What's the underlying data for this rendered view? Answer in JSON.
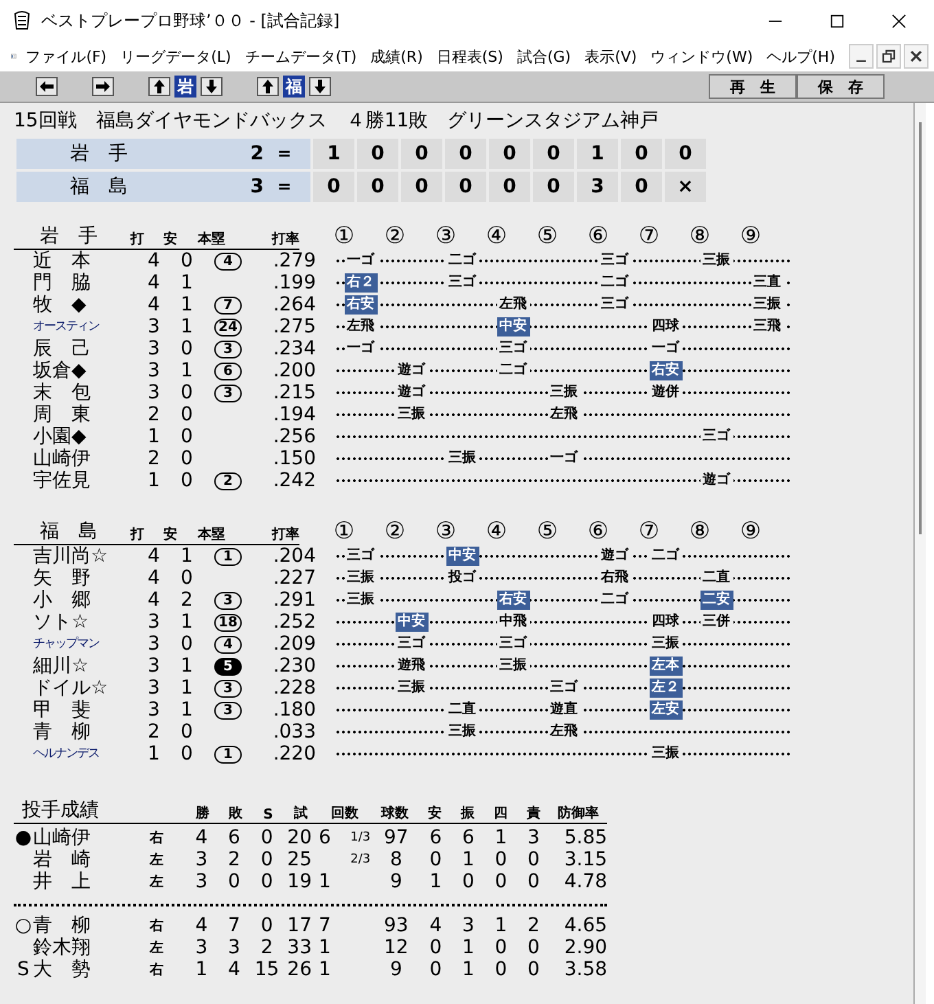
{
  "window": {
    "title": "ベストプレープロ野球’００ - [試合記録]"
  },
  "menu": [
    "ファイル(F)",
    "リーグデータ(L)",
    "チームデータ(T)",
    "成績(R)",
    "日程表(S)",
    "試合(G)",
    "表示(V)",
    "ウィンドウ(W)",
    "ヘルプ(H)"
  ],
  "toolbar": {
    "away_team": "岩",
    "home_team": "福",
    "buttons": [
      "再　生",
      "保　存"
    ]
  },
  "game_header": "15回戦　福島ダイヤモンドバックス　４勝11敗　グリーンスタジアム神戸",
  "scoreboard": [
    {
      "team": "岩　手",
      "total": "2",
      "equals": "＝",
      "innings": [
        "1",
        "0",
        "0",
        "0",
        "0",
        "0",
        "1",
        "0",
        "0"
      ]
    },
    {
      "team": "福　島",
      "total": "3",
      "equals": "＝",
      "innings": [
        "0",
        "0",
        "0",
        "0",
        "0",
        "0",
        "3",
        "0",
        "×"
      ]
    }
  ],
  "batting": [
    {
      "team": "岩　手",
      "columns": [
        "打",
        "安",
        "本塁",
        "打率"
      ],
      "inning_headers": [
        "①",
        "②",
        "③",
        "④",
        "⑤",
        "⑥",
        "⑦",
        "⑧",
        "⑨"
      ],
      "rows": [
        {
          "name": "近　本",
          "ab": "4",
          "h": "0",
          "hr": "4",
          "hr_filled": false,
          "avg": ".279",
          "innings": {
            "inning_1": {
              "text": "一ゴ",
              "hit": false
            },
            "inning_3": {
              "text": "二ゴ",
              "hit": false
            },
            "inning_6": {
              "text": "三ゴ",
              "hit": false
            },
            "inning_8": {
              "text": "三振",
              "hit": false
            }
          }
        },
        {
          "name": "門　脇",
          "ab": "4",
          "h": "1",
          "avg": ".199",
          "innings": {
            "inning_1": {
              "text": "右２",
              "hit": true
            },
            "inning_3": {
              "text": "三ゴ",
              "hit": false
            },
            "inning_6": {
              "text": "二ゴ",
              "hit": false
            },
            "inning_9": {
              "text": "三直",
              "hit": false
            }
          }
        },
        {
          "name": "牧　◆",
          "ab": "4",
          "h": "1",
          "hr": "7",
          "hr_filled": false,
          "avg": ".264",
          "innings": {
            "inning_1": {
              "text": "右安",
              "hit": true
            },
            "inning_4": {
              "text": "左飛",
              "hit": false
            },
            "inning_6": {
              "text": "三ゴ",
              "hit": false
            },
            "inning_9": {
              "text": "三振",
              "hit": false
            }
          }
        },
        {
          "name": "オースティン",
          "ab": "3",
          "h": "1",
          "hr": "24",
          "hr_filled": false,
          "avg": ".275",
          "innings": {
            "inning_1": {
              "text": "左飛",
              "hit": false
            },
            "inning_4": {
              "text": "中安",
              "hit": true
            },
            "inning_7": {
              "text": "四球",
              "hit": false
            },
            "inning_9": {
              "text": "三飛",
              "hit": false
            }
          }
        },
        {
          "name": "辰　己",
          "ab": "3",
          "h": "0",
          "hr": "3",
          "hr_filled": false,
          "avg": ".234",
          "innings": {
            "inning_1": {
              "text": "一ゴ",
              "hit": false
            },
            "inning_4": {
              "text": "三ゴ",
              "hit": false
            },
            "inning_7": {
              "text": "一ゴ",
              "hit": false
            }
          }
        },
        {
          "name": "坂倉◆",
          "ab": "3",
          "h": "1",
          "hr": "6",
          "hr_filled": false,
          "avg": ".200",
          "innings": {
            "inning_2": {
              "text": "遊ゴ",
              "hit": false
            },
            "inning_4": {
              "text": "二ゴ",
              "hit": false
            },
            "inning_7": {
              "text": "右安",
              "hit": true
            }
          }
        },
        {
          "name": "末　包",
          "ab": "3",
          "h": "0",
          "hr": "3",
          "hr_filled": false,
          "avg": ".215",
          "innings": {
            "inning_2": {
              "text": "遊ゴ",
              "hit": false
            },
            "inning_5": {
              "text": "三振",
              "hit": false
            },
            "inning_7": {
              "text": "遊併",
              "hit": false
            }
          }
        },
        {
          "name": "周　東",
          "ab": "2",
          "h": "0",
          "avg": ".194",
          "innings": {
            "inning_2": {
              "text": "三振",
              "hit": false
            },
            "inning_5": {
              "text": "左飛",
              "hit": false
            }
          }
        },
        {
          "name": "小園◆",
          "ab": "1",
          "h": "0",
          "avg": ".256",
          "innings": {
            "inning_8": {
              "text": "三ゴ",
              "hit": false
            }
          }
        },
        {
          "name": "山崎伊",
          "ab": "2",
          "h": "0",
          "avg": ".150",
          "innings": {
            "inning_3": {
              "text": "三振",
              "hit": false
            },
            "inning_5": {
              "text": "一ゴ",
              "hit": false
            }
          }
        },
        {
          "name": "宇佐見",
          "ab": "1",
          "h": "0",
          "hr": "2",
          "hr_filled": false,
          "avg": ".242",
          "innings": {
            "inning_8": {
              "text": "遊ゴ",
              "hit": false
            }
          }
        }
      ]
    },
    {
      "team": "福　島",
      "columns": [
        "打",
        "安",
        "本塁",
        "打率"
      ],
      "inning_headers": [
        "①",
        "②",
        "③",
        "④",
        "⑤",
        "⑥",
        "⑦",
        "⑧",
        "⑨"
      ],
      "rows": [
        {
          "name": "吉川尚☆",
          "ab": "4",
          "h": "1",
          "hr": "1",
          "hr_filled": false,
          "avg": ".204",
          "innings": {
            "inning_1": {
              "text": "三ゴ",
              "hit": false
            },
            "inning_3": {
              "text": "中安",
              "hit": true
            },
            "inning_6": {
              "text": "遊ゴ",
              "hit": false
            },
            "inning_7": {
              "text": "二ゴ",
              "hit": false
            }
          }
        },
        {
          "name": "矢　野",
          "ab": "4",
          "h": "0",
          "avg": ".227",
          "innings": {
            "inning_1": {
              "text": "三振",
              "hit": false
            },
            "inning_3": {
              "text": "投ゴ",
              "hit": false
            },
            "inning_6": {
              "text": "右飛",
              "hit": false
            },
            "inning_8": {
              "text": "二直",
              "hit": false
            }
          }
        },
        {
          "name": "小　郷",
          "ab": "4",
          "h": "2",
          "hr": "3",
          "hr_filled": false,
          "avg": ".291",
          "innings": {
            "inning_1": {
              "text": "三振",
              "hit": false
            },
            "inning_4": {
              "text": "右安",
              "hit": true
            },
            "inning_6": {
              "text": "二ゴ",
              "hit": false
            },
            "inning_8": {
              "text": "二安",
              "hit": true
            }
          }
        },
        {
          "name": "ソト☆",
          "ab": "3",
          "h": "1",
          "hr": "18",
          "hr_filled": false,
          "avg": ".252",
          "innings": {
            "inning_2": {
              "text": "中安",
              "hit": true
            },
            "inning_4": {
              "text": "中飛",
              "hit": false
            },
            "inning_7": {
              "text": "四球",
              "hit": false
            },
            "inning_8": {
              "text": "三併",
              "hit": false
            }
          }
        },
        {
          "name": "チャップマン",
          "ab": "3",
          "h": "0",
          "hr": "4",
          "hr_filled": false,
          "avg": ".209",
          "innings": {
            "inning_2": {
              "text": "三ゴ",
              "hit": false
            },
            "inning_4": {
              "text": "三ゴ",
              "hit": false
            },
            "inning_7": {
              "text": "三振",
              "hit": false
            }
          }
        },
        {
          "name": "細川☆",
          "ab": "3",
          "h": "1",
          "hr": "5",
          "hr_filled": true,
          "avg": ".230",
          "innings": {
            "inning_2": {
              "text": "遊飛",
              "hit": false
            },
            "inning_4": {
              "text": "三振",
              "hit": false
            },
            "inning_7": {
              "text": "左本",
              "hit": true
            }
          }
        },
        {
          "name": "ドイル☆",
          "ab": "3",
          "h": "1",
          "hr": "3",
          "hr_filled": false,
          "avg": ".228",
          "innings": {
            "inning_2": {
              "text": "三振",
              "hit": false
            },
            "inning_5": {
              "text": "三ゴ",
              "hit": false
            },
            "inning_7": {
              "text": "左２",
              "hit": true
            }
          }
        },
        {
          "name": "甲　斐",
          "ab": "3",
          "h": "1",
          "hr": "3",
          "hr_filled": false,
          "avg": ".180",
          "innings": {
            "inning_3": {
              "text": "二直",
              "hit": false
            },
            "inning_5": {
              "text": "遊直",
              "hit": false
            },
            "inning_7": {
              "text": "左安",
              "hit": true
            }
          }
        },
        {
          "name": "青　柳",
          "ab": "2",
          "h": "0",
          "avg": ".033",
          "innings": {
            "inning_3": {
              "text": "三振",
              "hit": false
            },
            "inning_5": {
              "text": "左飛",
              "hit": false
            }
          }
        },
        {
          "name": "ヘルナンデス",
          "ab": "1",
          "h": "0",
          "hr": "1",
          "hr_filled": false,
          "avg": ".220",
          "innings": {
            "inning_7": {
              "text": "三振",
              "hit": false
            }
          }
        }
      ]
    }
  ],
  "pitching": {
    "title": "投手成績",
    "columns": [
      "勝",
      "敗",
      "S",
      "試",
      "回数",
      "球数",
      "安",
      "振",
      "四",
      "責",
      "防御率"
    ],
    "groups": [
      [
        {
          "mark": "●",
          "name": "山崎伊",
          "hand": "右",
          "stats_a": [
            "4",
            "6",
            "0",
            "20"
          ],
          "ip": "6",
          "ip_frac": "1/3",
          "stats_b": [
            "97",
            "6",
            "6",
            "1",
            "3",
            "5.85"
          ]
        },
        {
          "name": "岩　崎",
          "hand": "左",
          "stats_a": [
            "3",
            "2",
            "0",
            "25"
          ],
          "ip_frac": "2/3",
          "stats_b": [
            "8",
            "0",
            "1",
            "0",
            "0",
            "3.15"
          ]
        },
        {
          "name": "井　上",
          "hand": "左",
          "stats_a": [
            "3",
            "0",
            "0",
            "19"
          ],
          "ip": "1",
          "stats_b": [
            "9",
            "1",
            "0",
            "0",
            "0",
            "4.78"
          ]
        }
      ],
      [
        {
          "mark": "○",
          "name": "青　柳",
          "hand": "右",
          "stats_a": [
            "4",
            "7",
            "0",
            "17"
          ],
          "ip": "7",
          "stats_b": [
            "93",
            "4",
            "3",
            "1",
            "2",
            "4.65"
          ]
        },
        {
          "name": "鈴木翔",
          "hand": "左",
          "stats_a": [
            "3",
            "3",
            "2",
            "33"
          ],
          "ip": "1",
          "stats_b": [
            "12",
            "0",
            "1",
            "0",
            "0",
            "2.90"
          ]
        },
        {
          "mark": "S",
          "name": "大　勢",
          "hand": "右",
          "stats_a": [
            "1",
            "4",
            "15",
            "26"
          ],
          "ip": "1",
          "stats_b": [
            "9",
            "0",
            "1",
            "0",
            "0",
            "3.58"
          ]
        }
      ]
    ]
  }
}
